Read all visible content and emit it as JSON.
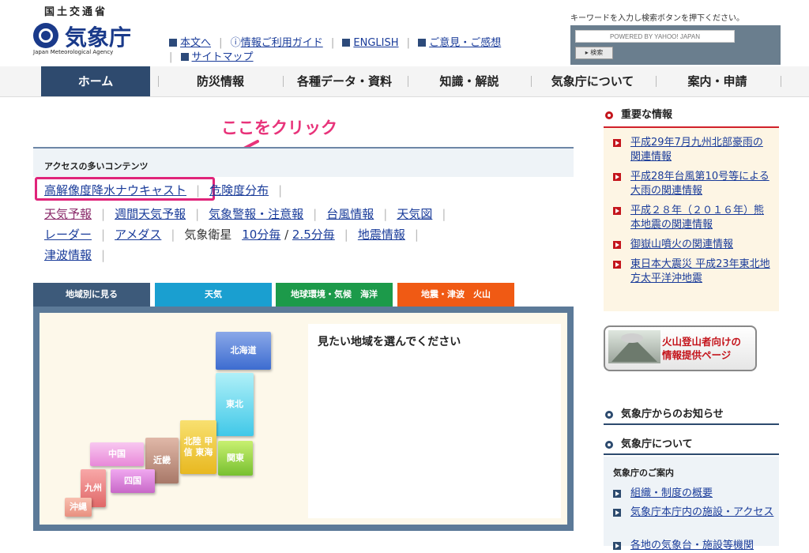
{
  "header": {
    "ministry": "国土交通省",
    "agency": "気象庁",
    "agency_en": "Japan Meteorological Agency",
    "utility_links": [
      "本文へ",
      "情報ご利用ガイド",
      "ENGLISH",
      "ご意見・ご感想",
      "サイトマップ"
    ],
    "search_hint": "キーワードを入力し検索ボタンを押下ください。",
    "search_powered": "POWERED BY YAHOO! JAPAN",
    "search_button": "▸ 検索"
  },
  "nav": [
    "ホーム",
    "防災情報",
    "各種データ・資料",
    "知識・解説",
    "気象庁について",
    "案内・申請"
  ],
  "annotation": "ここをクリック",
  "access": {
    "title": "アクセスの多いコンテンツ",
    "row1": [
      "高解像度降水ナウキャスト",
      "危険度分布"
    ],
    "row2": [
      "天気予報",
      "週間天気予報",
      "気象警報・注意報",
      "台風情報",
      "天気図"
    ],
    "row3_links": [
      "レーダー",
      "アメダス"
    ],
    "row3_text": "気象衛星",
    "row3_sat": [
      "10分毎",
      "/",
      "2.5分毎"
    ],
    "row3_more": "地震情報",
    "row4": [
      "津波情報"
    ]
  },
  "region_tabs": [
    {
      "label": "地域別に見る",
      "color": "#3d5a7a"
    },
    {
      "label": "天気",
      "color": "#1a9fd0"
    },
    {
      "label": "地球環境・気候　海洋",
      "color": "#1c9a4a"
    },
    {
      "label": "地震・津波　火山",
      "color": "#f05a14"
    }
  ],
  "map": {
    "prompt": "見たい地域を選んでください",
    "regions": {
      "hokkaido": "北海道",
      "tohoku": "東北",
      "kanto": "関東",
      "hokuriku": "北陸 甲信 東海",
      "kinki": "近畿",
      "chugoku": "中国",
      "shikoku": "四国",
      "kyushu": "九州",
      "okinawa": "沖縄"
    }
  },
  "important": {
    "title": "重要な情報",
    "items": [
      "平成29年7月九州北部豪雨の関連情報",
      "平成28年台風第10号等による大雨の関連情報",
      "平成２８年（２０１６年）熊本地震の関連情報",
      "御嶽山噴火の関連情報",
      "東日本大震災 平成23年東北地方太平洋沖地震"
    ]
  },
  "volcano_banner": "火山登山者向けの 情報提供ページ",
  "notice_title": "気象庁からのお知らせ",
  "about": {
    "title": "気象庁について",
    "sub": "気象庁のご案内",
    "items": [
      "組織・制度の概要",
      "気象庁本庁内の施設・アクセス",
      "各地の気象台・施設等機関"
    ]
  },
  "colors": {
    "nav_active": "#2e4a6e",
    "link": "#1a3c9a",
    "accent_red": "#c4151c",
    "annotation": "#e8337a"
  }
}
